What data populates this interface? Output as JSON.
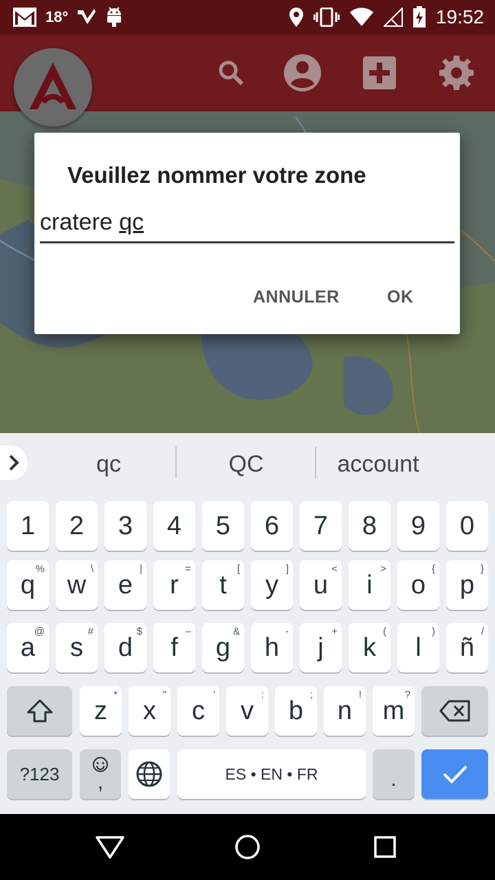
{
  "status_bar": {
    "temperature": "18°",
    "time": "19:52",
    "icons": [
      "gmail-icon",
      "weather-icon",
      "delivery-icon",
      "android-icon",
      "location-icon",
      "vibrate-icon",
      "wifi-icon",
      "signal-icon",
      "battery-icon"
    ]
  },
  "app_bar": {
    "actions": [
      "search-icon",
      "account-icon",
      "add-icon",
      "settings-icon"
    ],
    "colors": {
      "status": "#5a1114",
      "toolbar": "#6e1a1e",
      "logo_mark": "#6b1019"
    }
  },
  "dialog": {
    "title": "Veuillez nommer votre zone",
    "input_value_plain": "cratere ",
    "input_value_underlined": "qc",
    "cancel_label": "ANNULER",
    "ok_label": "OK"
  },
  "keyboard": {
    "suggestions": [
      "qc",
      "QC",
      "account"
    ],
    "row_numbers": [
      "1",
      "2",
      "3",
      "4",
      "5",
      "6",
      "7",
      "8",
      "9",
      "0"
    ],
    "row_q": [
      {
        "key": "q",
        "hint": "%"
      },
      {
        "key": "w",
        "hint": "\\"
      },
      {
        "key": "e",
        "hint": "|"
      },
      {
        "key": "r",
        "hint": "="
      },
      {
        "key": "t",
        "hint": "["
      },
      {
        "key": "y",
        "hint": "]"
      },
      {
        "key": "u",
        "hint": "<"
      },
      {
        "key": "i",
        "hint": ">"
      },
      {
        "key": "o",
        "hint": "{"
      },
      {
        "key": "p",
        "hint": "}"
      }
    ],
    "row_a": [
      {
        "key": "a",
        "hint": "@"
      },
      {
        "key": "s",
        "hint": "#"
      },
      {
        "key": "d",
        "hint": "$"
      },
      {
        "key": "f",
        "hint": "–"
      },
      {
        "key": "g",
        "hint": "&"
      },
      {
        "key": "h",
        "hint": "-"
      },
      {
        "key": "j",
        "hint": "+"
      },
      {
        "key": "k",
        "hint": "("
      },
      {
        "key": "l",
        "hint": ")"
      },
      {
        "key": "ñ",
        "hint": "/"
      }
    ],
    "row_z": [
      {
        "key": "z",
        "hint": "*"
      },
      {
        "key": "x",
        "hint": "\""
      },
      {
        "key": "c",
        "hint": "'"
      },
      {
        "key": "v",
        "hint": ":"
      },
      {
        "key": "b",
        "hint": ";"
      },
      {
        "key": "n",
        "hint": "!"
      },
      {
        "key": "m",
        "hint": "?"
      }
    ],
    "symbols_label": "?123",
    "comma_label": ",",
    "space_label": "ES • EN • FR",
    "period_label": ".",
    "enter_color": "#4a8df0"
  },
  "nav_bar": {
    "buttons": [
      "back-icon",
      "home-icon",
      "recents-icon"
    ]
  }
}
